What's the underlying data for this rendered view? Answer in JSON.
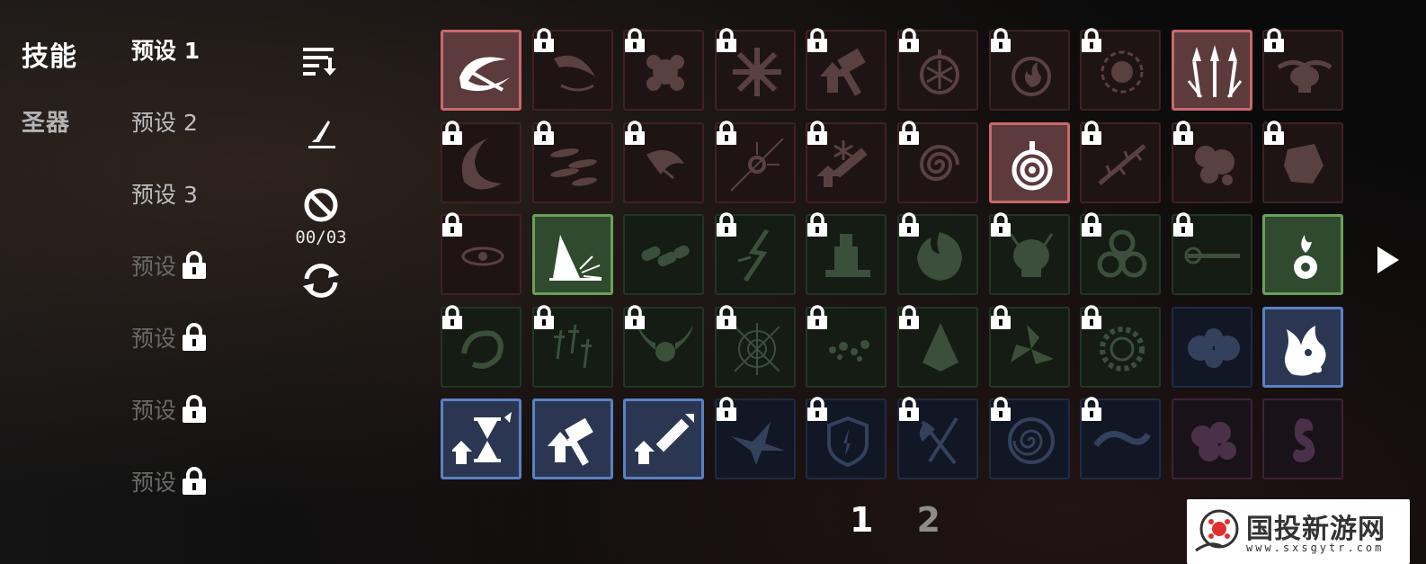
{
  "nav": {
    "categories": [
      {
        "label": "技能",
        "active": true
      },
      {
        "label": "圣器",
        "active": false
      }
    ]
  },
  "presets": [
    {
      "label": "预设 1",
      "state": "active"
    },
    {
      "label": "预设 2",
      "state": "normal"
    },
    {
      "label": "预设 3",
      "state": "normal"
    },
    {
      "label": "预设",
      "state": "locked"
    },
    {
      "label": "预设",
      "state": "locked"
    },
    {
      "label": "预设",
      "state": "locked"
    },
    {
      "label": "预设",
      "state": "locked"
    }
  ],
  "tools": {
    "sort_icon": "sort-icon",
    "edit_icon": "pen-icon",
    "clear_icon": "ban-icon",
    "counter": "00/03",
    "refresh_icon": "refresh-icon"
  },
  "skills": {
    "rows": [
      [
        {
          "icon": "slash-swirl-icon",
          "rarity": "red",
          "equipped": true,
          "locked": false
        },
        {
          "icon": "blade-arc-icon",
          "rarity": "red",
          "equipped": false,
          "locked": true
        },
        {
          "icon": "rose-burst-icon",
          "rarity": "red",
          "equipped": false,
          "locked": true
        },
        {
          "icon": "star-burst-icon",
          "rarity": "red",
          "equipped": false,
          "locked": true
        },
        {
          "icon": "hammer-up-icon",
          "rarity": "red",
          "equipped": false,
          "locked": true
        },
        {
          "icon": "snowflake-orb-icon",
          "rarity": "red",
          "equipped": false,
          "locked": true
        },
        {
          "icon": "fire-orb-icon",
          "rarity": "red",
          "equipped": false,
          "locked": true
        },
        {
          "icon": "dark-vortex-icon",
          "rarity": "red",
          "equipped": false,
          "locked": true
        },
        {
          "icon": "triple-spear-icon",
          "rarity": "red",
          "equipped": true,
          "locked": false
        },
        {
          "icon": "skull-cloud-icon",
          "rarity": "red",
          "equipped": false,
          "locked": true
        }
      ],
      [
        {
          "icon": "crescent-icon",
          "rarity": "red",
          "equipped": false,
          "locked": true
        },
        {
          "icon": "feather-rain-icon",
          "rarity": "red",
          "equipped": false,
          "locked": true
        },
        {
          "icon": "dragon-claw-icon",
          "rarity": "red",
          "equipped": false,
          "locked": true
        },
        {
          "icon": "crosshair-icon",
          "rarity": "red",
          "equipped": false,
          "locked": true
        },
        {
          "icon": "frost-sword-icon",
          "rarity": "red",
          "equipped": false,
          "locked": true
        },
        {
          "icon": "spiral-icon",
          "rarity": "red",
          "equipped": false,
          "locked": true
        },
        {
          "icon": "target-bomb-icon",
          "rarity": "red",
          "equipped": true,
          "locked": false
        },
        {
          "icon": "thorn-vine-icon",
          "rarity": "red",
          "equipped": false,
          "locked": true
        },
        {
          "icon": "smoke-blob-icon",
          "rarity": "red",
          "equipped": false,
          "locked": true
        },
        {
          "icon": "gauntlet-icon",
          "rarity": "red",
          "equipped": false,
          "locked": true
        }
      ],
      [
        {
          "icon": "eye-void-icon",
          "rarity": "red",
          "equipped": false,
          "locked": true
        },
        {
          "icon": "ground-slam-icon",
          "rarity": "green",
          "equipped": true,
          "locked": false
        },
        {
          "icon": "chain-link-icon",
          "rarity": "green",
          "equipped": false,
          "locked": false
        },
        {
          "icon": "lightning-crack-icon",
          "rarity": "green",
          "equipped": false,
          "locked": true
        },
        {
          "icon": "tower-icon",
          "rarity": "green",
          "equipped": false,
          "locked": true
        },
        {
          "icon": "flame-wheel-icon",
          "rarity": "green",
          "equipped": false,
          "locked": true
        },
        {
          "icon": "demon-skull-icon",
          "rarity": "green",
          "equipped": false,
          "locked": true
        },
        {
          "icon": "biohazard-icon",
          "rarity": "green",
          "equipped": false,
          "locked": true
        },
        {
          "icon": "laser-beam-icon",
          "rarity": "green",
          "equipped": false,
          "locked": true
        },
        {
          "icon": "flame-bomb-icon",
          "rarity": "green",
          "equipped": true,
          "locked": false
        }
      ],
      [
        {
          "icon": "hook-swirl-icon",
          "rarity": "green",
          "equipped": false,
          "locked": true
        },
        {
          "icon": "dagger-rain-icon",
          "rarity": "green",
          "equipped": false,
          "locked": true
        },
        {
          "icon": "winged-orb-icon",
          "rarity": "green",
          "equipped": false,
          "locked": true
        },
        {
          "icon": "cobweb-icon",
          "rarity": "green",
          "equipped": false,
          "locked": true
        },
        {
          "icon": "scatter-icon",
          "rarity": "green",
          "equipped": false,
          "locked": true
        },
        {
          "icon": "drill-icon",
          "rarity": "green",
          "equipped": false,
          "locked": true
        },
        {
          "icon": "tri-blade-icon",
          "rarity": "green",
          "equipped": false,
          "locked": true
        },
        {
          "icon": "gear-ring-icon",
          "rarity": "green",
          "equipped": false,
          "locked": true
        },
        {
          "icon": "hex-shield-icon",
          "rarity": "blue",
          "equipped": false,
          "locked": false
        },
        {
          "icon": "ghost-flame-icon",
          "rarity": "blue",
          "equipped": true,
          "locked": false
        }
      ],
      [
        {
          "icon": "hourglass-up-icon",
          "rarity": "blue",
          "equipped": true,
          "locked": false
        },
        {
          "icon": "hammer-up-icon",
          "rarity": "blue",
          "equipped": true,
          "locked": false
        },
        {
          "icon": "sword-up-icon",
          "rarity": "blue",
          "equipped": true,
          "locked": false
        },
        {
          "icon": "storm-bird-icon",
          "rarity": "blue",
          "equipped": false,
          "locked": true
        },
        {
          "icon": "burst-shield-icon",
          "rarity": "blue",
          "equipped": false,
          "locked": true
        },
        {
          "icon": "axe-cross-icon",
          "rarity": "blue",
          "equipped": false,
          "locked": true
        },
        {
          "icon": "shell-spiral-icon",
          "rarity": "blue",
          "equipped": false,
          "locked": true
        },
        {
          "icon": "serpent-icon",
          "rarity": "blue",
          "equipped": false,
          "locked": true
        },
        {
          "icon": "cloud-cluster-icon",
          "rarity": "purple",
          "equipped": false,
          "locked": false
        },
        {
          "icon": "fox-spirit-icon",
          "rarity": "purple",
          "equipped": false,
          "locked": false
        }
      ]
    ]
  },
  "pagination": {
    "pages": [
      "1",
      "2"
    ],
    "current": "1",
    "next_icon": "play-right-icon"
  },
  "watermark": {
    "title": "国投新游网",
    "url": "www.sxsgytr.com"
  },
  "colors": {
    "red_equipped": "#c9686a",
    "green_equipped": "#6aa05a",
    "blue_equipped": "#5b81c4",
    "purple": "#3a2338"
  }
}
